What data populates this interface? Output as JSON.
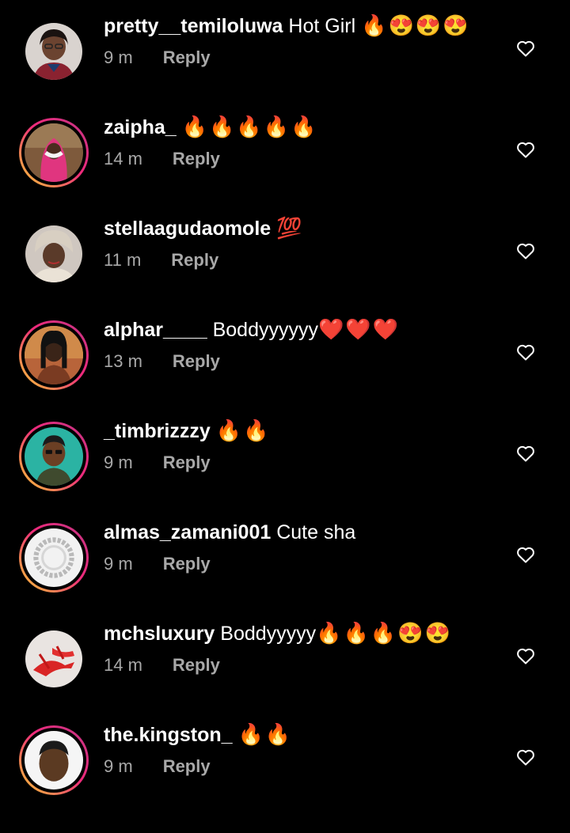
{
  "comments": [
    {
      "username": "pretty__temiloluwa",
      "text": "Hot Girl ",
      "emoji": "🔥😍😍😍",
      "time": "9 m",
      "reply": "Reply"
    },
    {
      "username": "zaipha_",
      "text": " ",
      "emoji": "🔥🔥🔥🔥🔥",
      "time": "14 m",
      "reply": "Reply"
    },
    {
      "username": "stellaagudaomole",
      "text": " ",
      "emoji": "💯",
      "time": "11 m",
      "reply": "Reply"
    },
    {
      "username": "alphar____",
      "text": " Boddyyyyyy",
      "emoji": "❤️❤️❤️",
      "time": "13 m",
      "reply": "Reply"
    },
    {
      "username": "_timbrizzzy",
      "text": " ",
      "emoji": "🔥🔥",
      "time": "9 m",
      "reply": "Reply"
    },
    {
      "username": "almas_zamani001",
      "text": " Cute sha",
      "emoji": "",
      "time": "9 m",
      "reply": "Reply"
    },
    {
      "username": "mchsluxury",
      "text": " Boddyyyyy",
      "emoji": "🔥🔥🔥😍😍",
      "time": "14 m",
      "reply": "Reply"
    },
    {
      "username": "the.kingston_",
      "text": " ",
      "emoji": "🔥🔥",
      "time": "9 m",
      "reply": "Reply"
    }
  ],
  "icons": {
    "like": "heart-outline-icon"
  },
  "colors": {
    "background": "#000000",
    "text": "#ffffff",
    "secondary_text": "#a8a8a8",
    "story_ring_start": "#f9ce34",
    "story_ring_end": "#c13584"
  }
}
